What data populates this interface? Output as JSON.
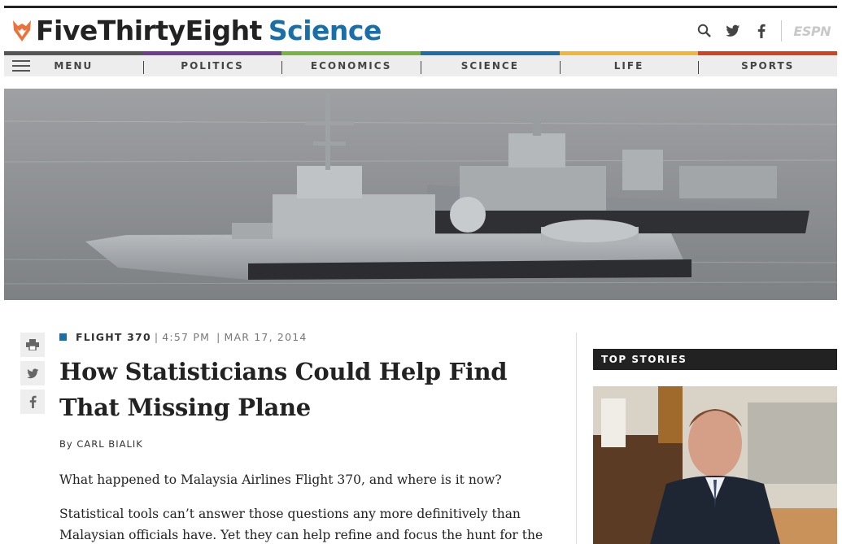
{
  "brand": {
    "name": "FiveThirtyEight",
    "section": "Science",
    "espn": "ESPN",
    "colors": {
      "brand_orange": "#ed713a",
      "science_blue": "#1a6fa8"
    }
  },
  "header_icons": [
    "search-icon",
    "twitter-icon",
    "facebook-icon"
  ],
  "nav": {
    "menu_label": "MENU",
    "items": [
      {
        "label": "POLITICS",
        "color": "#6e3d8f"
      },
      {
        "label": "ECONOMICS",
        "color": "#78b53f"
      },
      {
        "label": "SCIENCE",
        "color": "#1a6fa8"
      },
      {
        "label": "LIFE",
        "color": "#f2b632"
      },
      {
        "label": "SPORTS",
        "color": "#d4431f"
      }
    ],
    "menu_color": "#555555"
  },
  "share_icons": [
    "print-icon",
    "twitter-icon",
    "facebook-icon"
  ],
  "article": {
    "tag": "FLIGHT 370",
    "time": "4:57 PM",
    "date": "MAR 17, 2014",
    "title": "How Statisticians Could Help Find That Missing Plane",
    "byline_prefix": "By",
    "author": "CARL BIALIK",
    "para1": "What happened to Malaysia Airlines Flight 370, and where is it now?",
    "para2": "Statistical tools can’t answer those questions any more definitively than Malaysian officials have. Yet they can help refine and focus the hunt for the"
  },
  "sidebar": {
    "heading": "TOP STORIES"
  }
}
